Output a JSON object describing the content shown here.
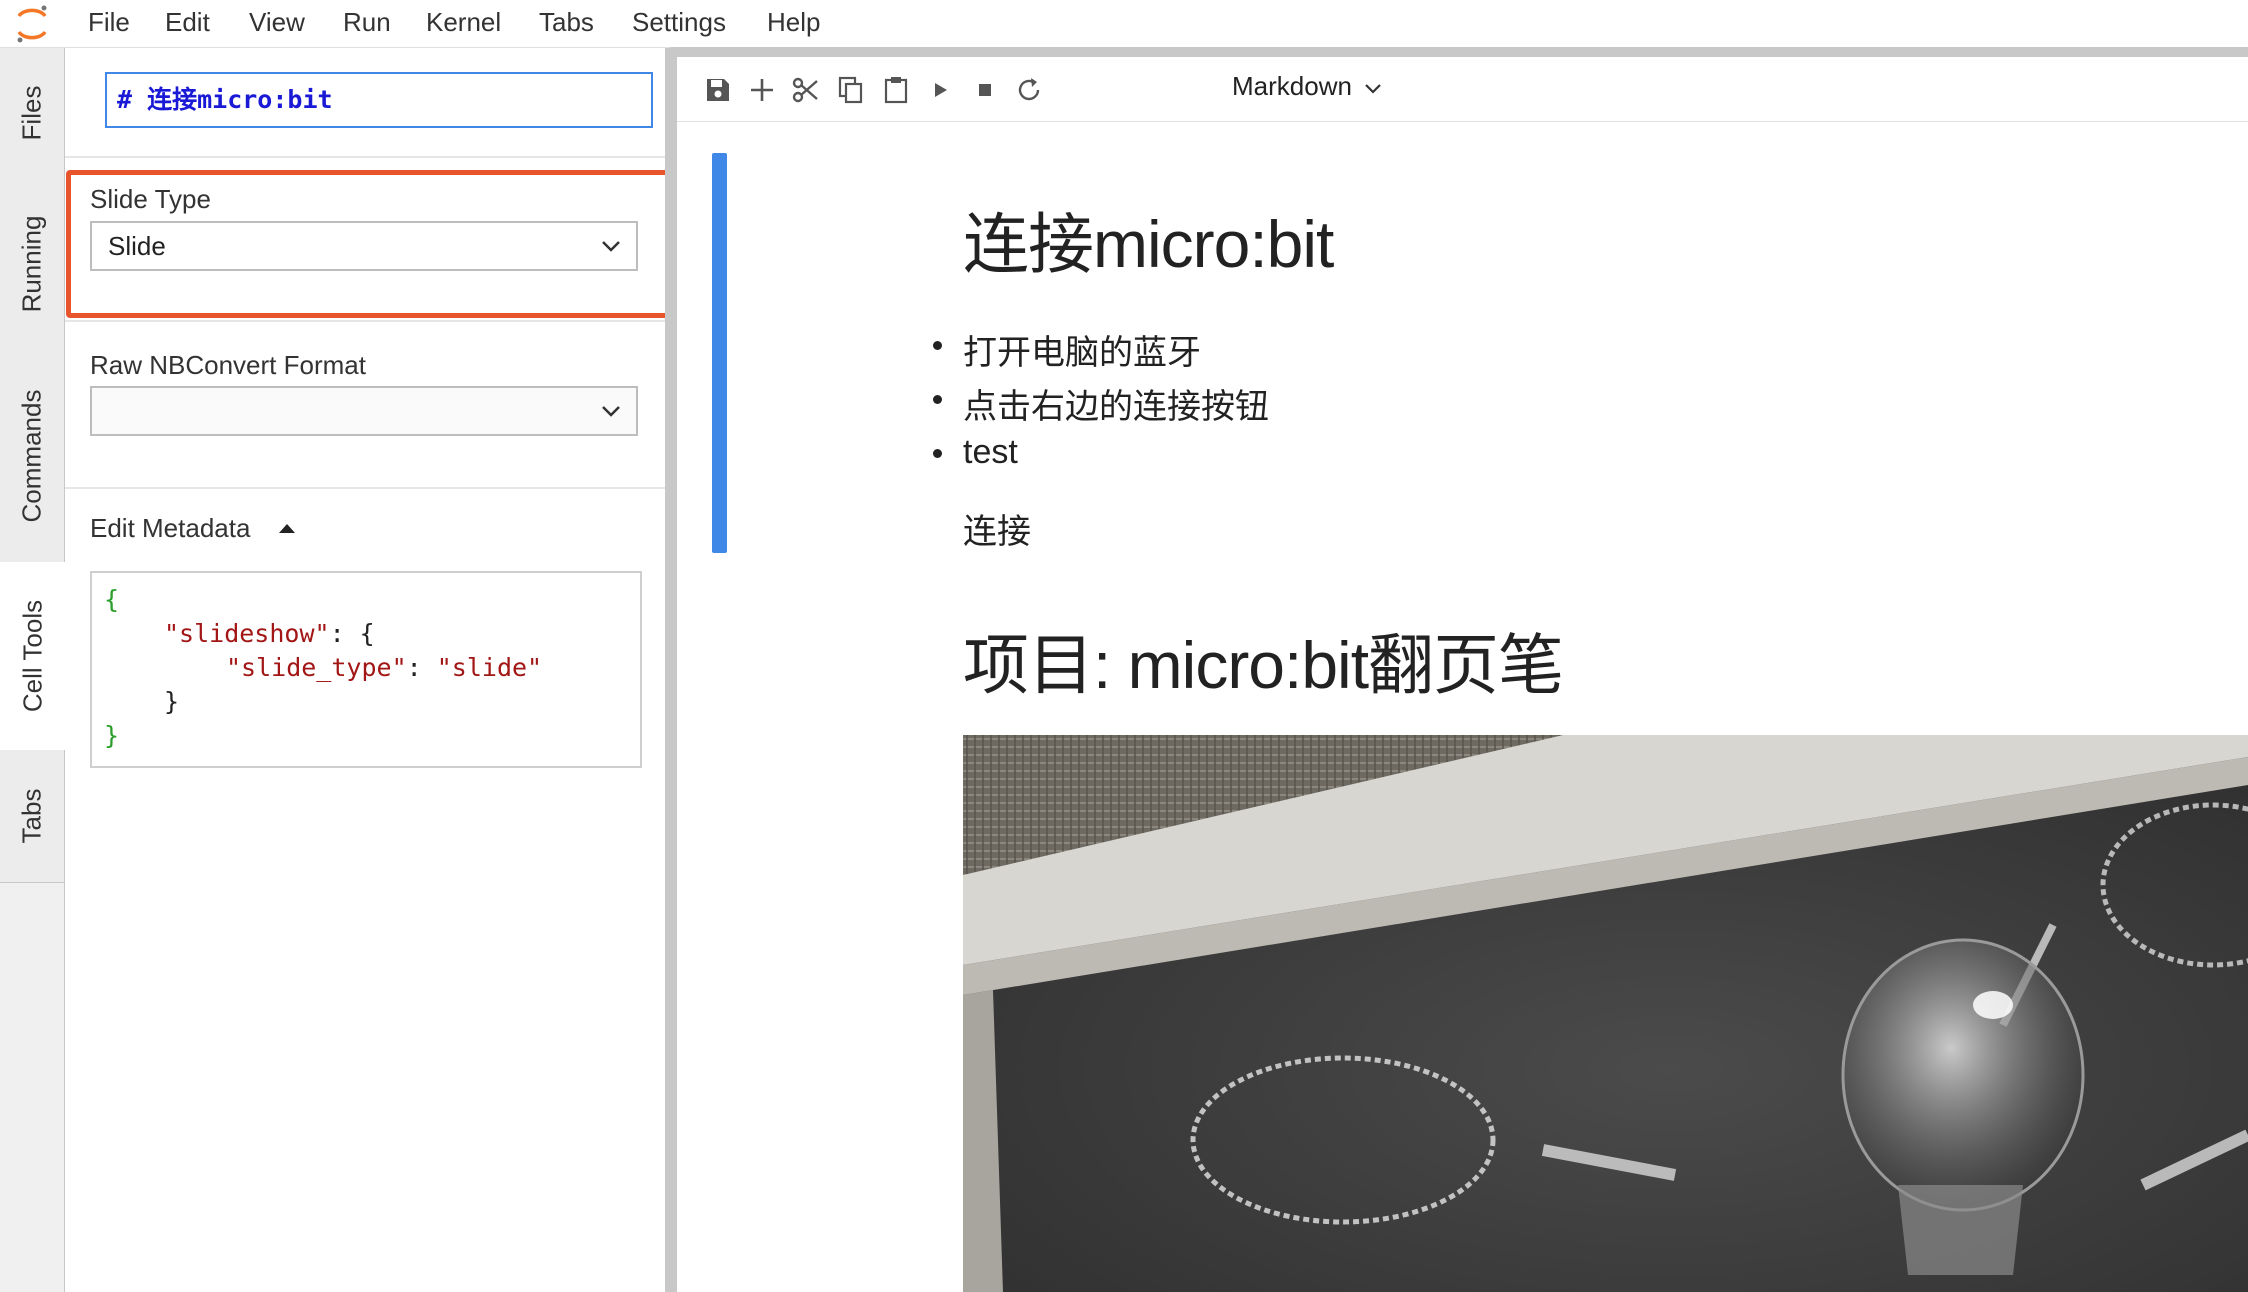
{
  "menu": [
    "File",
    "Edit",
    "View",
    "Run",
    "Kernel",
    "Tabs",
    "Settings",
    "Help"
  ],
  "left_tabs": [
    "Files",
    "Running",
    "Commands",
    "Cell Tools",
    "Tabs"
  ],
  "active_left_tab": "Cell Tools",
  "cell_tools": {
    "cell_preview": "# 连接micro:bit",
    "slide_type_label": "Slide Type",
    "slide_type_value": "Slide",
    "raw_format_label": "Raw NBConvert Format",
    "raw_format_value": "",
    "edit_metadata_label": "Edit Metadata",
    "metadata": {
      "open_brace": "{",
      "key_slideshow": "\"slideshow\"",
      "colon_open": ": {",
      "key_slide_type": "\"slide_type\"",
      "colon": ": ",
      "value_slide": "\"slide\"",
      "inner_close": "}",
      "close_brace": "}"
    },
    "highlight_color": "#e8552c"
  },
  "toolbar": {
    "icons": [
      "save-icon",
      "add-cell-icon",
      "cut-icon",
      "copy-icon",
      "paste-icon",
      "run-icon",
      "stop-icon",
      "restart-icon"
    ],
    "cell_type": "Markdown"
  },
  "notebook": {
    "heading1": "连接micro:bit",
    "bullets": [
      "打开电脑的蓝牙",
      "点击右边的连接按钮",
      "test"
    ],
    "paragraph": "连接",
    "heading2": "项目: micro:bit翻页笔",
    "accent_color": "#3f88e8"
  }
}
